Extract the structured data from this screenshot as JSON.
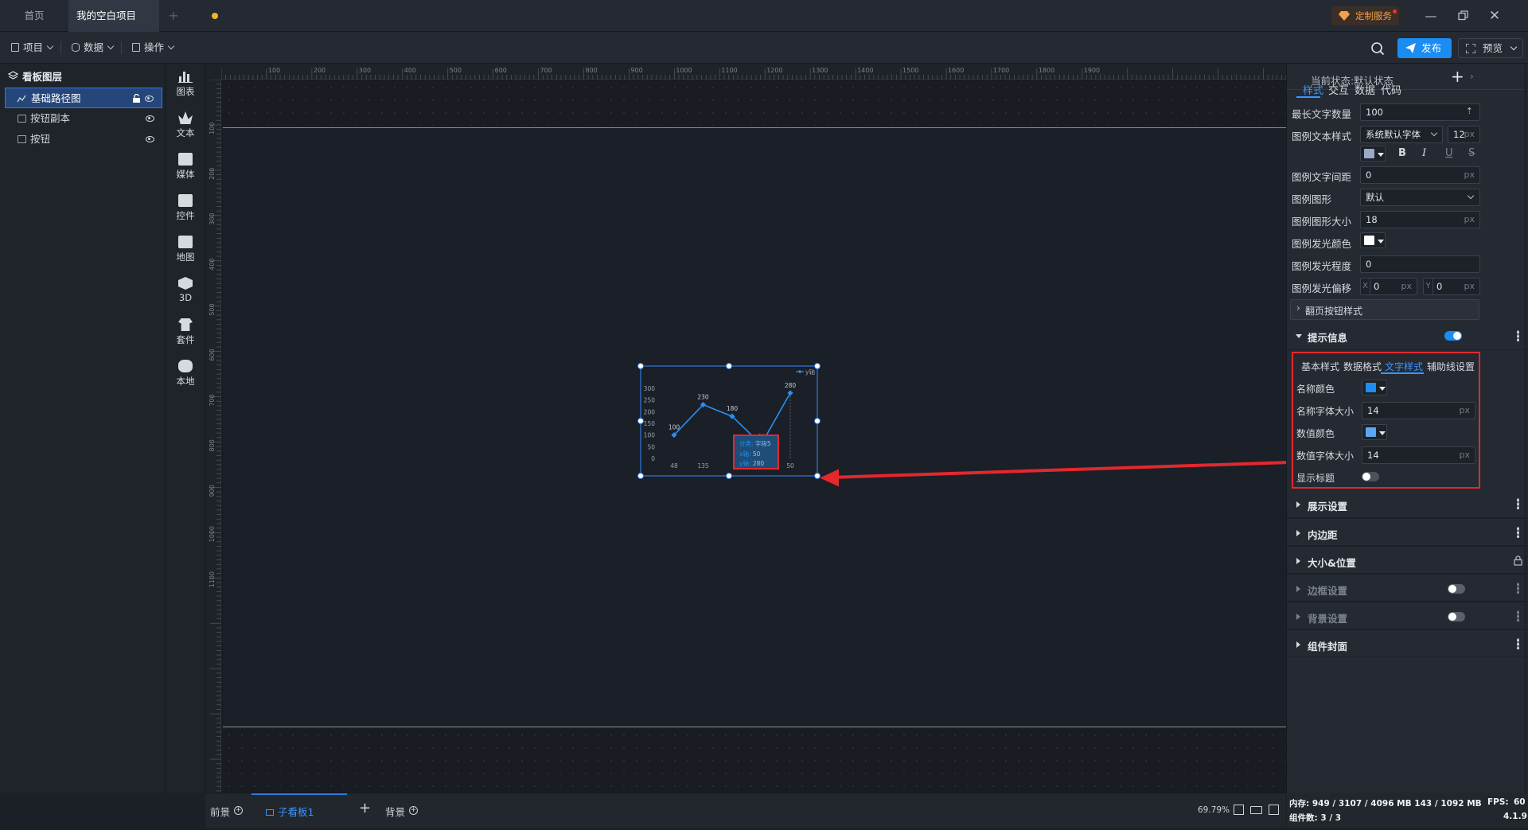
{
  "titlebar": {
    "tabs": [
      "首页",
      "我的空白项目"
    ],
    "custom_service": "定制服务"
  },
  "menubar": {
    "items": [
      "项目",
      "数据",
      "操作"
    ],
    "publish": "发布",
    "preview": "预览"
  },
  "layers": {
    "title": "看板图层",
    "items": [
      "基础路径图",
      "按钮副本",
      "按钮"
    ]
  },
  "tools": [
    "图表",
    "文本",
    "媒体",
    "控件",
    "地图",
    "3D",
    "套件",
    "本地"
  ],
  "rulers": {
    "top": [
      "100",
      "200",
      "300",
      "400",
      "500",
      "600",
      "700",
      "800",
      "900",
      "1000",
      "1100",
      "1200",
      "1300",
      "1400",
      "1500",
      "1600",
      "1700",
      "1800",
      "1900"
    ],
    "left": [
      "100",
      "200",
      "300",
      "400",
      "500",
      "600",
      "700",
      "800",
      "900",
      "1000",
      "1100"
    ]
  },
  "chart_data": {
    "type": "line",
    "categories": [
      "48",
      "135",
      "",
      "",
      "50"
    ],
    "values": [
      100,
      230,
      180,
      60,
      280
    ],
    "point_labels": [
      "100",
      "230",
      "180",
      "60",
      "280"
    ],
    "yticks": [
      "300",
      "250",
      "200",
      "150",
      "100",
      "50",
      "0"
    ],
    "ylim": [
      0,
      300
    ],
    "legend": "y轴",
    "tooltip": {
      "rows": [
        {
          "k": "分类:",
          "v": "字段5"
        },
        {
          "k": "x轴:",
          "v": "50"
        },
        {
          "k": "y轴:",
          "v": "280"
        }
      ]
    },
    "colors": {
      "line": "#2a8ff0",
      "highlight": "#e3282e"
    }
  },
  "bottombar": {
    "tabs": [
      "前景",
      "子看板1",
      "背景"
    ],
    "zoom": "69.79%"
  },
  "rightpanel": {
    "state_label": "当前状态:",
    "state_value": "默认状态",
    "tabs": [
      "样式",
      "交互",
      "数据",
      "代码"
    ],
    "rows": {
      "max_text": {
        "label": "最长文字数量",
        "value": "100"
      },
      "legend_text_style": {
        "label": "图例文本样式",
        "font": "系统默认字体",
        "size": "12",
        "unit": "px"
      },
      "legend_text_spacing": {
        "label": "图例文字间距",
        "value": "0",
        "unit": "px"
      },
      "legend_shape": {
        "label": "图例图形",
        "value": "默认"
      },
      "legend_shape_size": {
        "label": "图例图形大小",
        "value": "18",
        "unit": "px"
      },
      "legend_glow_color": {
        "label": "图例发光颜色"
      },
      "legend_glow_level": {
        "label": "图例发光程度",
        "value": "0"
      },
      "legend_glow_offset": {
        "label": "图例发光偏移",
        "x_label": "X",
        "x": "0",
        "y_label": "Y",
        "y": "0",
        "unit": "px"
      }
    },
    "paging_style": "翻页按钮样式",
    "tooltip_section": "提示信息",
    "tooltip_tabs": [
      "基本样式",
      "数据格式",
      "文字样式",
      "辅助线设置"
    ],
    "tooltip_rows": {
      "name_color": {
        "label": "名称颜色",
        "color": "#1e8ef0"
      },
      "name_font_size": {
        "label": "名称字体大小",
        "value": "14",
        "unit": "px"
      },
      "value_color": {
        "label": "数值颜色",
        "color": "#5aa7f2"
      },
      "value_font_size": {
        "label": "数值字体大小",
        "value": "14",
        "unit": "px"
      },
      "show_title": {
        "label": "显示标题"
      }
    },
    "sections": [
      "展示设置",
      "内边距",
      "大小&位置",
      "边框设置",
      "背景设置",
      "组件封面"
    ]
  },
  "status": {
    "memory": "内存: 949 / 3107 / 4096 MB  143 / 1092 MB",
    "fps_label": "FPS:",
    "fps": "60",
    "components": "组件数: 3 / 3",
    "version": "4.1.9"
  }
}
